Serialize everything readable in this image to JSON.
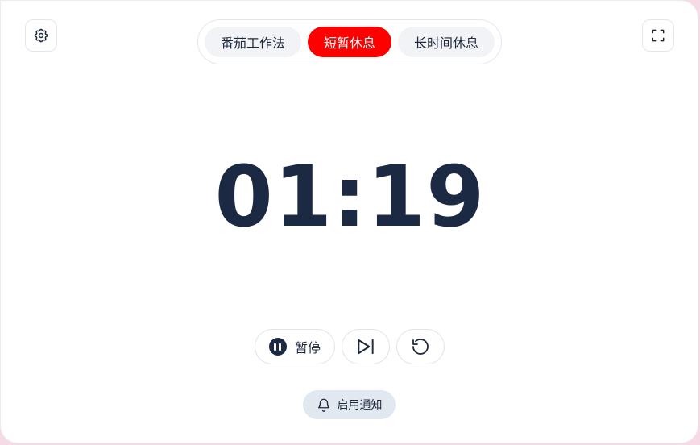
{
  "header": {
    "settings_icon": "gear-icon",
    "fullscreen_icon": "fullscreen-icon"
  },
  "tabs": [
    {
      "label": "番茄工作法",
      "active": false
    },
    {
      "label": "短暂休息",
      "active": true
    },
    {
      "label": "长时间休息",
      "active": false
    }
  ],
  "timer": {
    "display": "01:19"
  },
  "controls": {
    "pause_label": "暂停",
    "pause_icon": "pause-icon",
    "skip_icon": "skip-next-icon",
    "reset_icon": "reset-icon"
  },
  "notification": {
    "label": "启用通知",
    "icon": "bell-icon"
  },
  "colors": {
    "accent": "#ff0000",
    "text_dark": "#1c2943",
    "tab_bg": "#f1f3f7",
    "notify_bg": "#e2e8f0"
  }
}
